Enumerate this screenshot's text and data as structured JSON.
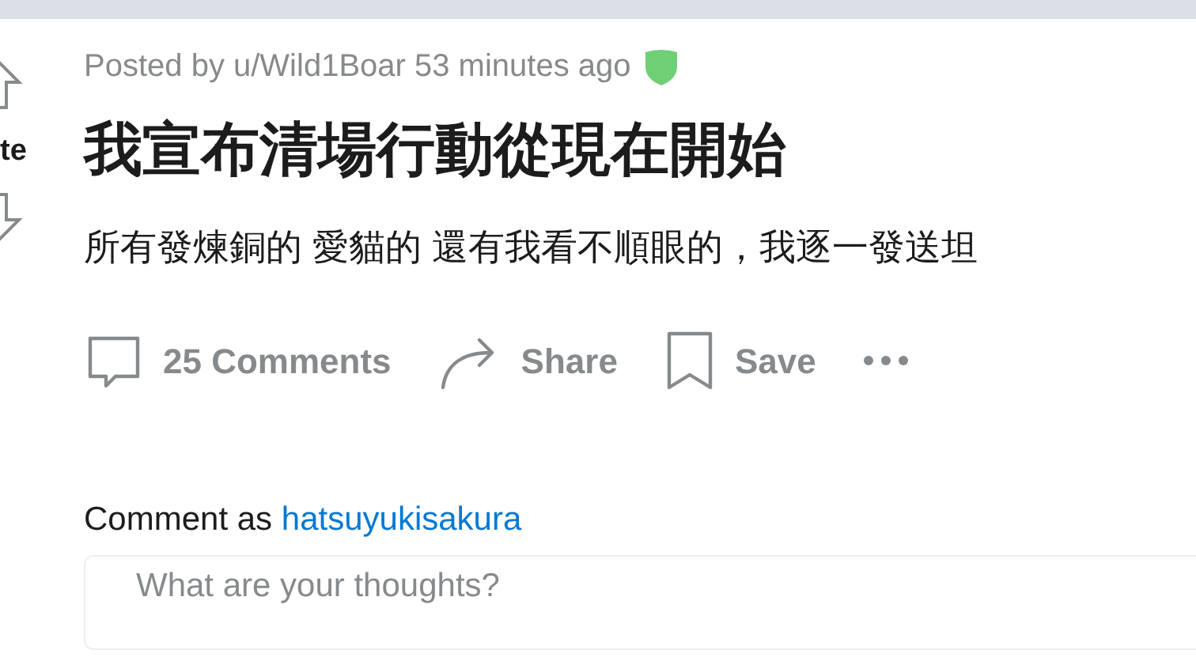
{
  "vote": {
    "label": "te"
  },
  "post": {
    "meta": "Posted by u/Wild1Boar 53 minutes ago",
    "title": "我宣布清場行動從現在開始",
    "body": "所有發煉銅的 愛貓的 還有我看不順眼的，我逐一發送坦"
  },
  "actions": [
    {
      "kind": "comments",
      "label": "25 Comments"
    },
    {
      "kind": "share",
      "label": "Share"
    },
    {
      "kind": "save",
      "label": "Save"
    },
    {
      "kind": "more"
    }
  ],
  "comment": {
    "prefix": "Comment as",
    "user": "hatsuyukisakura",
    "placeholder": "What are your thoughts?"
  }
}
